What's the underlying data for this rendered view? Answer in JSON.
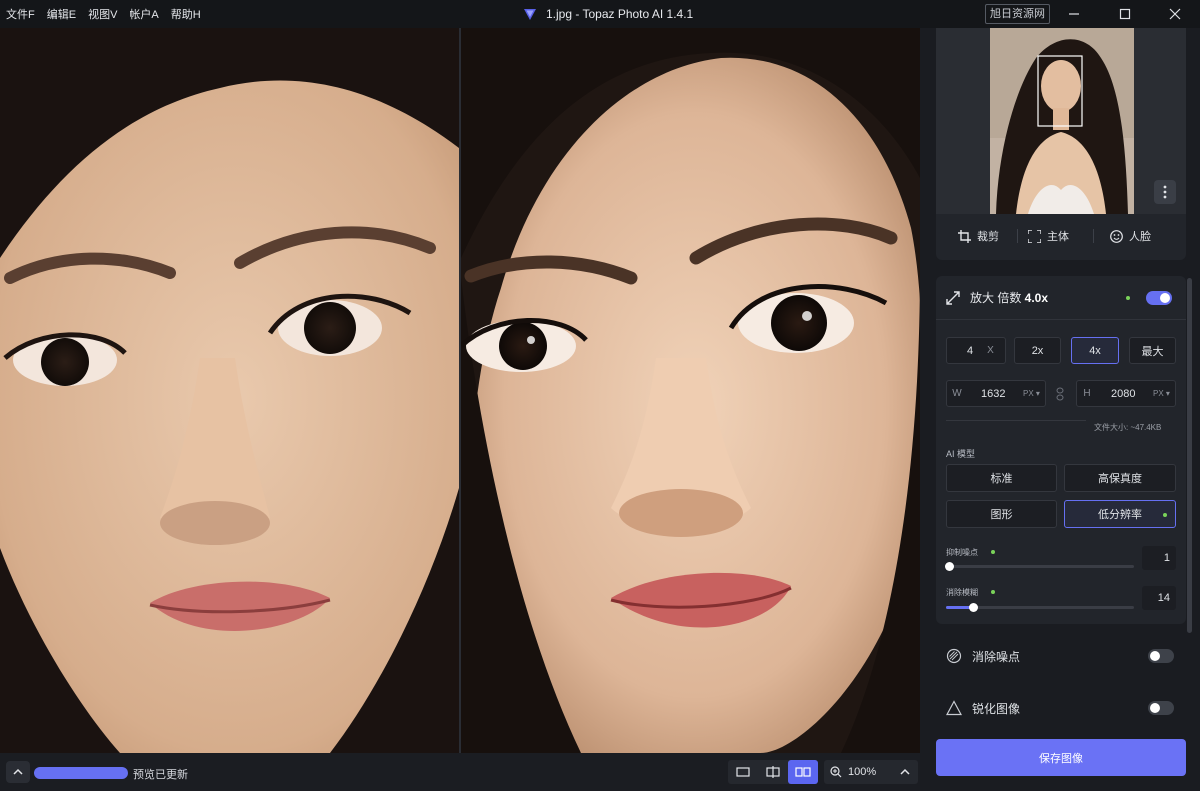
{
  "menu": [
    {
      "label": "文件F"
    },
    {
      "label": "编辑E"
    },
    {
      "label": "视图V"
    },
    {
      "label": "帐户A"
    },
    {
      "label": "帮助H"
    }
  ],
  "window": {
    "title": "1.jpg - Topaz Photo AI 1.4.1",
    "badge": "旭日资源网"
  },
  "status": {
    "text": "预览已更新",
    "zoom": "100%",
    "active_view": "side-by-side"
  },
  "navigator": {
    "tools": [
      {
        "label": "裁剪",
        "icon": "crop-icon"
      },
      {
        "label": "主体",
        "icon": "subject-frame-icon"
      },
      {
        "label": "人脸",
        "icon": "face-icon"
      }
    ]
  },
  "upscale": {
    "title_prefix": "放大 倍数 ",
    "title_value": "4.0x",
    "enabled": true,
    "scale_value": "4",
    "scale_unit": "X",
    "presets": [
      "2x",
      "4x",
      "最大"
    ],
    "selected_preset": "4x",
    "width_label": "W",
    "width_value": "1632",
    "height_label": "H",
    "height_value": "2080",
    "unit": "PX ▾",
    "file_size": "文件大小: ~47.4KB",
    "model_label": "AI 模型",
    "models": [
      "标准",
      "高保真度",
      "图形",
      "低分辨率"
    ],
    "selected_model": "低分辨率",
    "sliders": [
      {
        "label": "抑制噪点",
        "value": "1",
        "level": 0.0
      },
      {
        "label": "消除模糊",
        "value": "14",
        "level": 0.14
      }
    ]
  },
  "features": [
    {
      "label": "消除噪点",
      "enabled": false,
      "icon": "denoise-icon"
    },
    {
      "label": "锐化图像",
      "enabled": false,
      "icon": "sharpen-icon"
    }
  ],
  "save_label": "保存图像",
  "colors": {
    "accent": "#6670f2",
    "panel": "#22252b",
    "background": "#16181d",
    "indicator": "#7ad35a"
  }
}
